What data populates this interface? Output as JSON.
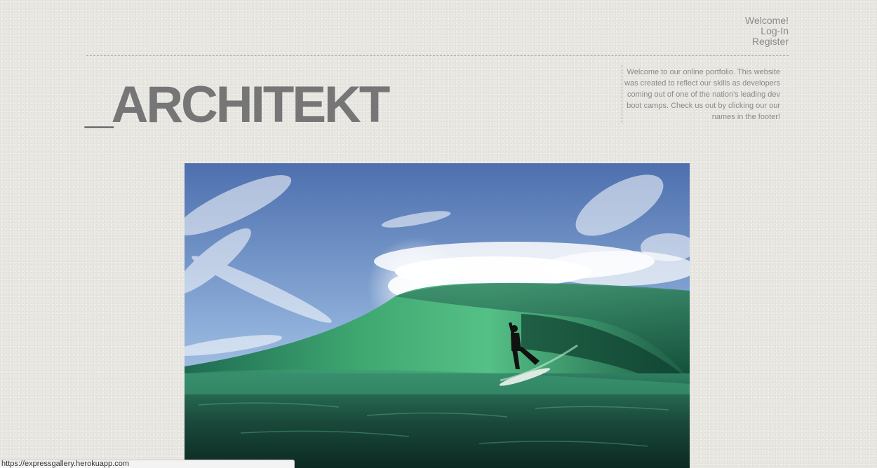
{
  "user_nav": {
    "welcome": "Welcome!",
    "login": "Log-In",
    "register": "Register"
  },
  "header": {
    "title": "_ARCHITEKT",
    "intro": "Welcome to our online portfolio. This website was created to reflect our skills as developers coming out of one of the nation's leading dev boot camps. Check us out by clicking our our names in the footer!"
  },
  "hero": {
    "subject": "surfer riding inside a green barrel wave",
    "colors": {
      "sky_top": "#4d6fae",
      "sky_bottom": "#b8cde6",
      "wave_light": "#4fb77e",
      "wave_dark": "#0f4a36",
      "spray": "#ffffff"
    }
  },
  "status_bar": {
    "url": "https://expressgallery.herokuapp.com"
  },
  "colors": {
    "background": "#e9e7e2",
    "title": "#767676",
    "text": "#8a8a8a",
    "divider": "#a9a9a9"
  }
}
